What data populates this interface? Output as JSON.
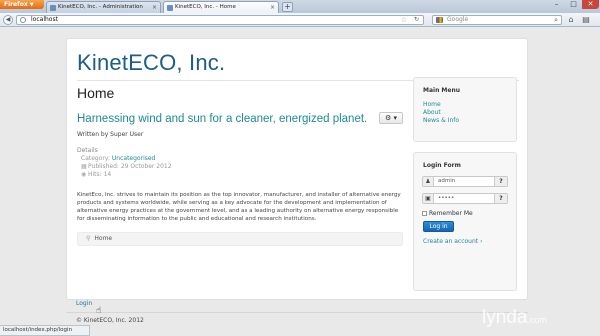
{
  "browser": {
    "app_button": "Firefox",
    "tabs": [
      {
        "label": "KinetECO, Inc. - Administration",
        "active": false
      },
      {
        "label": "KinetECO, Inc. - Home",
        "active": true
      }
    ],
    "new_tab": "+",
    "window_controls": {
      "minimize": "–",
      "maximize": "□",
      "close": "✕"
    },
    "url": "localhost",
    "search_placeholder": "Google",
    "status_url": "localhost/index.php/login"
  },
  "site": {
    "title": "KinetECO, Inc.",
    "page_heading": "Home"
  },
  "article": {
    "title": "Harnessing wind and sun for a cleaner, energized planet.",
    "tools_icon": "⚙ ▾",
    "author": "Written by Super User",
    "details_label": "Details",
    "category_prefix": "Category: ",
    "category_link": "Uncategorised",
    "published": "Published: 29 October 2012",
    "hits": "Hits: 14",
    "body": "KinetEco, Inc. strives to maintain its position as the top innovator, manufacturer, and installer of alternative energy products and systems worldwide, while serving as a key advocate for the development and implementation of alternative energy practices at the government level, and as a leading authority on alternative energy responsible for disseminating information to the public and educational and research institutions.",
    "pager": "Home"
  },
  "main_menu": {
    "title": "Main Menu",
    "items": [
      "Home",
      "About",
      "News & Info"
    ]
  },
  "login_form": {
    "title": "Login Form",
    "username": "admin",
    "password": "•••••",
    "remember_label": "Remember Me",
    "login_button": "Log in",
    "create_account": "Create an account"
  },
  "footer": {
    "login_link": "Login",
    "copyright": "© KinetECO, Inc. 2012"
  },
  "watermark": {
    "text": "lynda",
    "suffix": ".com"
  },
  "colors": {
    "brand": "#1d5d86",
    "link": "#1f8a97",
    "button": "#1667b3"
  }
}
